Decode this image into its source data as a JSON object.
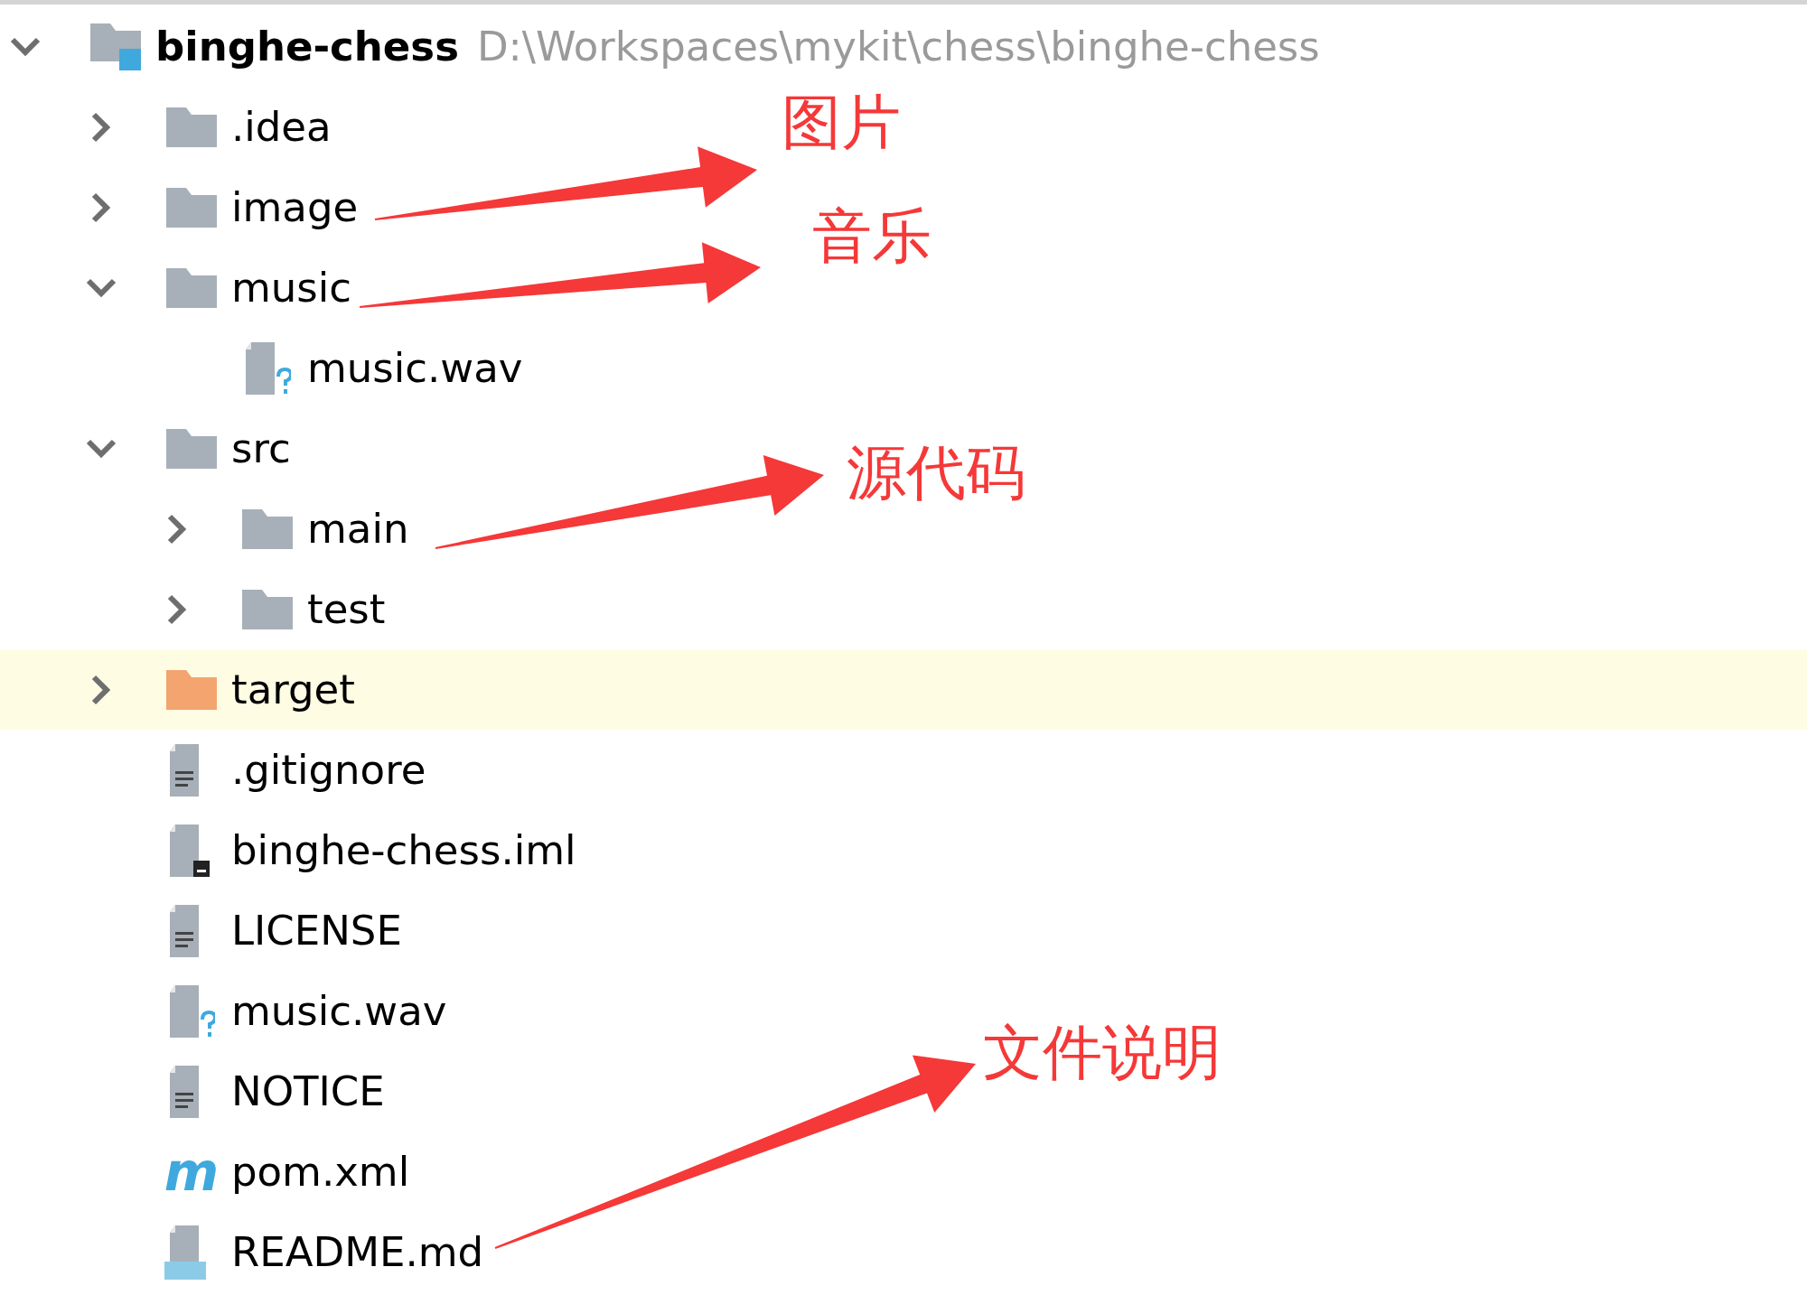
{
  "project_tree": {
    "root": {
      "name": "binghe-chess",
      "path": "D:\\Workspaces\\mykit\\chess\\binghe-chess",
      "kind": "module",
      "expanded": true,
      "selected": false,
      "children": [
        {
          "name": ".idea",
          "kind": "folder",
          "expanded": false,
          "selected": false
        },
        {
          "name": "image",
          "kind": "folder",
          "expanded": false,
          "selected": false
        },
        {
          "name": "music",
          "kind": "folder",
          "expanded": true,
          "selected": false,
          "children": [
            {
              "name": "music.wav",
              "kind": "unknown_file",
              "selected": false
            }
          ]
        },
        {
          "name": "src",
          "kind": "folder",
          "expanded": true,
          "selected": false,
          "children": [
            {
              "name": "main",
              "kind": "folder",
              "expanded": false,
              "selected": false
            },
            {
              "name": "test",
              "kind": "folder",
              "expanded": false,
              "selected": false
            }
          ]
        },
        {
          "name": "target",
          "kind": "excluded_folder",
          "expanded": false,
          "selected": true
        },
        {
          "name": ".gitignore",
          "kind": "text_file",
          "selected": false
        },
        {
          "name": "binghe-chess.iml",
          "kind": "iml_file",
          "selected": false
        },
        {
          "name": "LICENSE",
          "kind": "text_file",
          "selected": false
        },
        {
          "name": "music.wav",
          "kind": "unknown_file",
          "selected": false
        },
        {
          "name": "NOTICE",
          "kind": "text_file",
          "selected": false
        },
        {
          "name": "pom.xml",
          "kind": "maven_file",
          "icon_text": "m",
          "selected": false
        },
        {
          "name": "README.md",
          "kind": "markdown_file",
          "selected": false
        }
      ]
    }
  },
  "annotations": [
    {
      "text": "图片"
    },
    {
      "text": "音乐"
    },
    {
      "text": "源代码"
    },
    {
      "text": "文件说明"
    }
  ]
}
